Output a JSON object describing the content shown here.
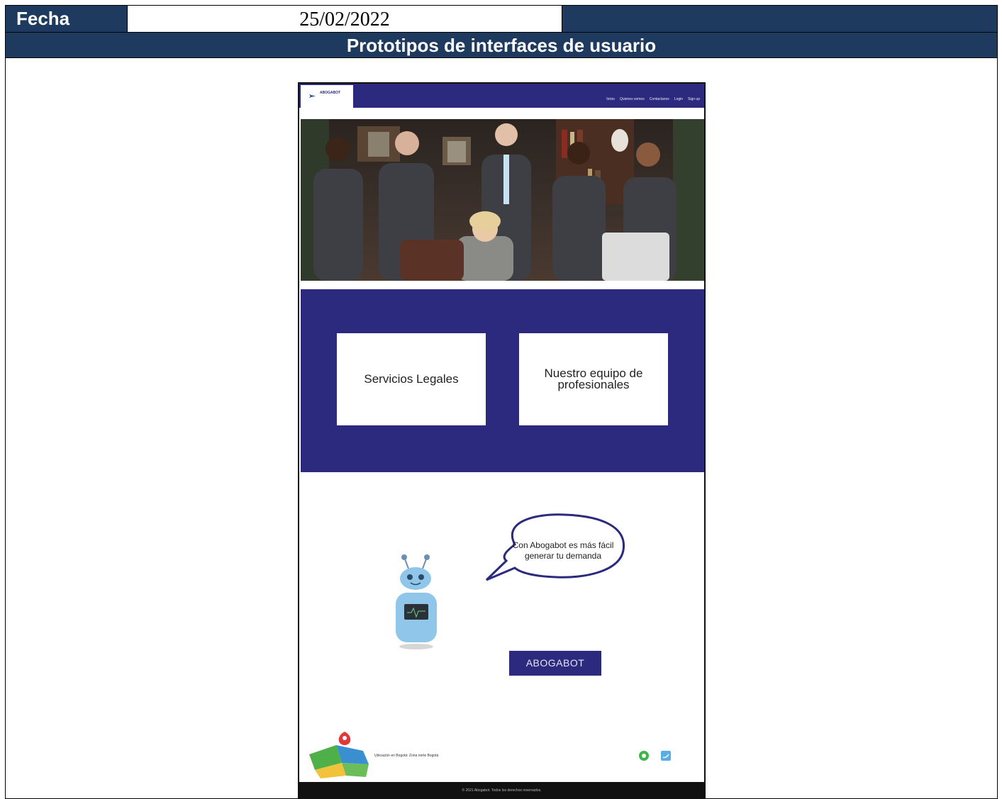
{
  "header": {
    "fecha_label": "Fecha",
    "fecha_value": "25/02/2022",
    "section_title": "Prototipos de interfaces de usuario"
  },
  "prototype": {
    "logo_text": "ABOGABOT",
    "nav_links": [
      "Inicio",
      "Quienes somos",
      "Contactanos",
      "Login",
      "Sign up"
    ],
    "service_cards": [
      "Servicios Legales",
      "Nuestro equipo de profesionales"
    ],
    "bubble_text": "Con Abogabot es más fácil generar tu demanda",
    "cta_label": "ABOGABOT",
    "footer_address": "Ubicación en Bogotá: Zona norte Bogotá",
    "copyright": "© 2021 Abogabot. Todos los derechos reservados."
  },
  "colors": {
    "doc_header_navy": "#1f3a5f",
    "prototype_navy": "#2b2a7e"
  }
}
